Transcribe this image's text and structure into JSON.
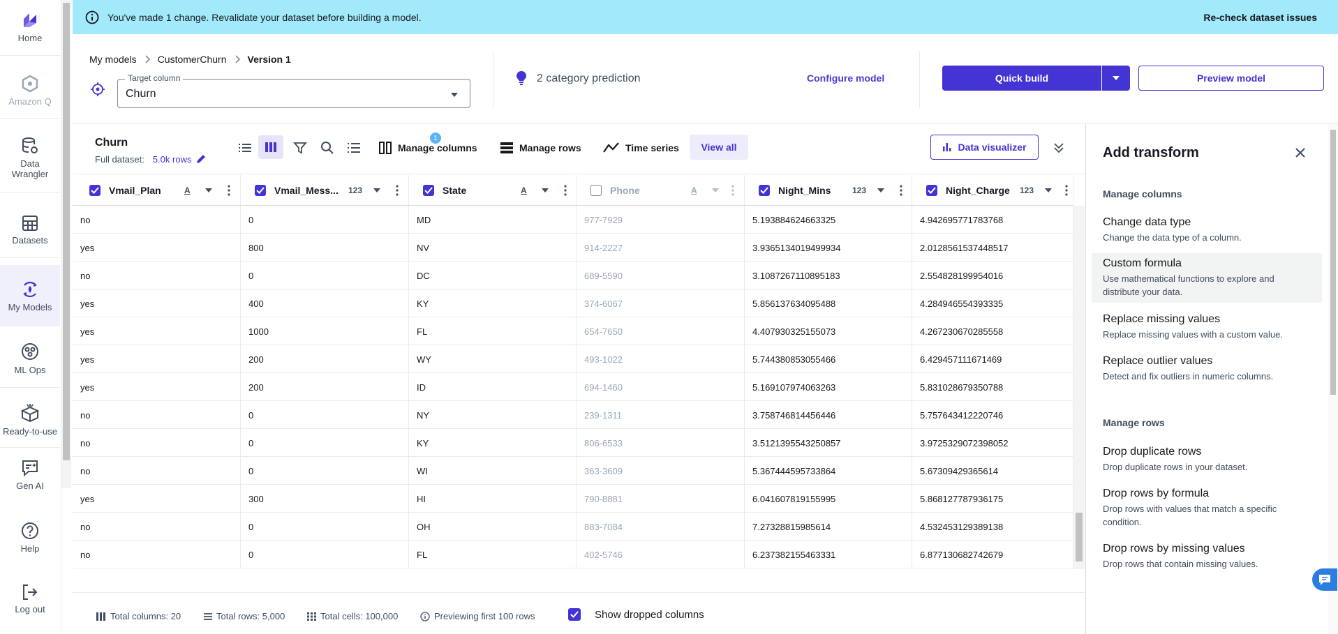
{
  "nav": {
    "items": [
      {
        "label": "Home",
        "icon": "home-logo-icon"
      },
      {
        "label": "Amazon Q",
        "icon": "amazon-q-icon"
      },
      {
        "label": "Data Wrangler",
        "icon": "database-icon"
      },
      {
        "label": "Datasets",
        "icon": "grid-table-icon"
      },
      {
        "label": "My Models",
        "icon": "models-icon"
      },
      {
        "label": "ML Ops",
        "icon": "ml-ops-icon"
      },
      {
        "label": "Ready-to-use",
        "icon": "box-icon"
      },
      {
        "label": "Gen AI",
        "icon": "chat-ai-icon"
      },
      {
        "label": "Help",
        "icon": "help-circle-icon"
      },
      {
        "label": "Log out",
        "icon": "logout-icon"
      }
    ]
  },
  "banner": {
    "message": "You've made 1 change. Revalidate your dataset before building a model.",
    "action": "Re-check dataset issues"
  },
  "header": {
    "breadcrumb": [
      "My models",
      "CustomerChurn",
      "Version 1"
    ],
    "target_label": "Target column",
    "target_value": "Churn",
    "prediction": "2 category prediction",
    "configure": "Configure model",
    "quick_build": "Quick build",
    "preview": "Preview model"
  },
  "toolbar": {
    "dataset_name": "Churn",
    "full_dataset_label": "Full dataset:",
    "rows": "5.0k rows",
    "badge": "1",
    "manage_columns": "Manage columns",
    "manage_rows": "Manage rows",
    "time_series": "Time series",
    "view_all": "View all",
    "data_visualizer": "Data visualizer"
  },
  "grid": {
    "columns": [
      {
        "name": "Vmail_Plan",
        "type": "A",
        "checked": true
      },
      {
        "name": "Vmail_Mess...",
        "type": "123",
        "checked": true
      },
      {
        "name": "State",
        "type": "A",
        "checked": true
      },
      {
        "name": "Phone",
        "type": "A",
        "checked": false
      },
      {
        "name": "Night_Mins",
        "type": "123",
        "checked": true
      },
      {
        "name": "Night_Charge",
        "type": "123",
        "checked": true
      }
    ],
    "rows": [
      [
        "no",
        "0",
        "MD",
        "977-7929",
        "5.193884624663325",
        "4.942695771783768"
      ],
      [
        "yes",
        "800",
        "NV",
        "914-2227",
        "3.9365134019499934",
        "2.0128561537448517"
      ],
      [
        "no",
        "0",
        "DC",
        "689-5590",
        "3.1087267110895183",
        "2.554828199954016"
      ],
      [
        "yes",
        "400",
        "KY",
        "374-6067",
        "5.856137634095488",
        "4.284946554393335"
      ],
      [
        "yes",
        "1000",
        "FL",
        "654-7650",
        "4.407930325155073",
        "4.267230670285558"
      ],
      [
        "yes",
        "200",
        "WY",
        "493-1022",
        "5.744380853055466",
        "6.429457111671469"
      ],
      [
        "yes",
        "200",
        "ID",
        "694-1460",
        "5.169107974063263",
        "5.831028679350788"
      ],
      [
        "no",
        "0",
        "NY",
        "239-1311",
        "3.758746814456446",
        "5.757643412220746"
      ],
      [
        "no",
        "0",
        "KY",
        "806-6533",
        "3.5121395543250857",
        "3.9725329072398052"
      ],
      [
        "no",
        "0",
        "WI",
        "363-3609",
        "5.367444595733864",
        "5.67309429365614"
      ],
      [
        "yes",
        "300",
        "HI",
        "790-8881",
        "6.041607819155995",
        "5.868127787936175"
      ],
      [
        "no",
        "0",
        "OH",
        "883-7084",
        "7.27328815985614",
        "4.532453129389138"
      ],
      [
        "no",
        "0",
        "FL",
        "402-5746",
        "6.237382155463331",
        "6.877130682742679"
      ]
    ]
  },
  "footer": {
    "total_columns": "Total columns: 20",
    "total_rows": "Total rows: 5,000",
    "total_cells": "Total cells: 100,000",
    "previewing": "Previewing first 100 rows",
    "show_dropped": "Show dropped columns"
  },
  "panel": {
    "title": "Add transform",
    "sections": [
      {
        "title": "Manage columns",
        "items": [
          {
            "title": "Change data type",
            "desc": "Change the data type of a column."
          },
          {
            "title": "Custom formula",
            "desc": "Use mathematical functions to explore and distribute your data."
          },
          {
            "title": "Replace missing values",
            "desc": "Replace missing values with a custom value."
          },
          {
            "title": "Replace outlier values",
            "desc": "Detect and fix outliers in numeric columns."
          }
        ]
      },
      {
        "title": "Manage rows",
        "items": [
          {
            "title": "Drop duplicate rows",
            "desc": "Drop duplicate rows in your dataset."
          },
          {
            "title": "Drop rows by formula",
            "desc": "Drop rows with values that match a specific condition."
          },
          {
            "title": "Drop rows by missing values",
            "desc": "Drop rows that contain missing values."
          }
        ]
      }
    ]
  },
  "colors": {
    "accent": "#4434d4",
    "banner": "#a2e9fb"
  }
}
